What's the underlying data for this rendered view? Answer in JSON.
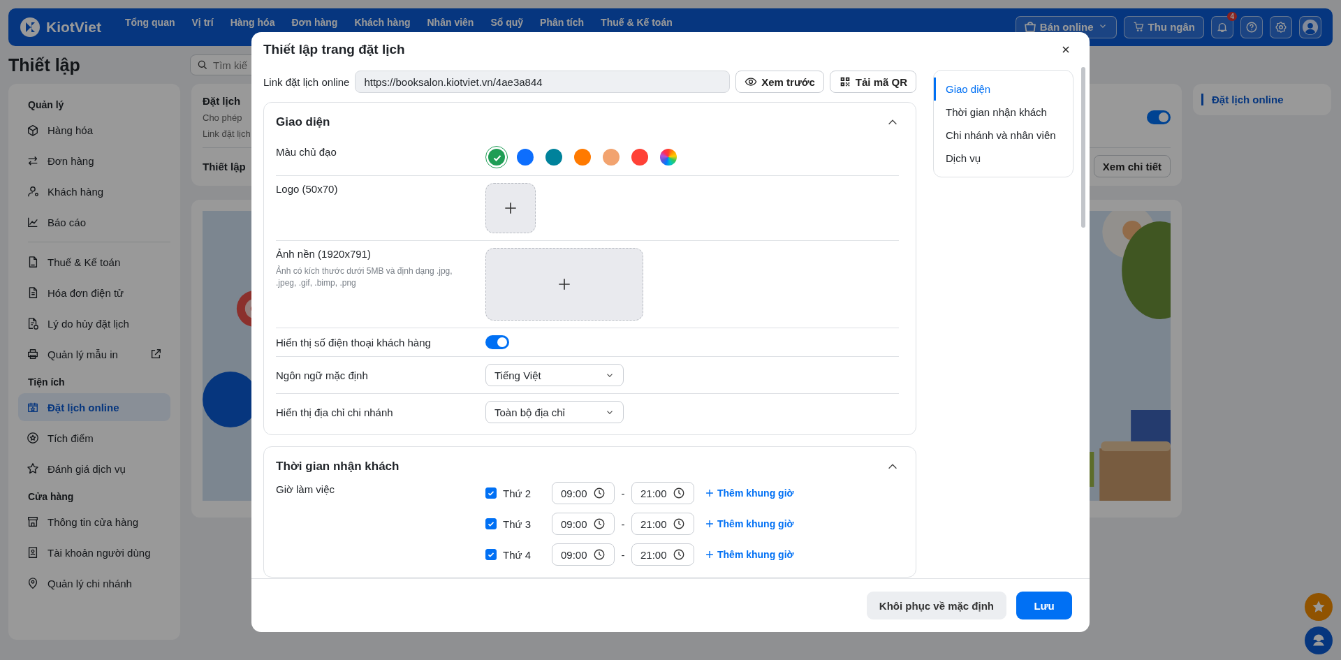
{
  "nav": {
    "logo": "KiotViet",
    "items": [
      {
        "label": "Tổng quan"
      },
      {
        "label": "Vị trí"
      },
      {
        "label": "Hàng hóa"
      },
      {
        "label": "Đơn hàng"
      },
      {
        "label": "Khách hàng"
      },
      {
        "label": "Nhân viên"
      },
      {
        "label": "Sổ quỹ"
      },
      {
        "label": "Phân tích"
      },
      {
        "label": "Thuế & Kế toán"
      }
    ],
    "sell_button": "Bán online",
    "cashier_button": "Thu ngân",
    "notification_count": "4"
  },
  "page": {
    "title": "Thiết lập",
    "search": {
      "placeholder": "Tìm kiế"
    }
  },
  "sidebar": {
    "groups": [
      {
        "heading": "Quản lý",
        "items": [
          {
            "label": "Hàng hóa",
            "selected": false,
            "external": false
          },
          {
            "label": "Đơn hàng",
            "selected": false,
            "external": false
          },
          {
            "label": "Khách hàng",
            "selected": false,
            "external": false
          },
          {
            "label": "Báo cáo",
            "selected": false,
            "external": false
          }
        ]
      },
      {
        "items": [
          {
            "label": "Thuế & Kế toán",
            "selected": false,
            "external": false
          },
          {
            "label": "Hóa đơn điện tử",
            "selected": false,
            "external": false
          },
          {
            "label": "Lý do hủy đặt lịch",
            "selected": false,
            "external": false
          },
          {
            "label": "Quản lý mẫu in",
            "selected": false,
            "external": true
          }
        ]
      },
      {
        "heading": "Tiện ích",
        "items": [
          {
            "label": "Đặt lịch online",
            "selected": true,
            "external": false
          },
          {
            "label": "Tích điểm",
            "selected": false,
            "external": false
          },
          {
            "label": "Đánh giá dịch vụ",
            "selected": false,
            "external": false
          }
        ]
      },
      {
        "heading": "Cửa hàng",
        "items": [
          {
            "label": "Thông tin cửa hàng",
            "selected": false,
            "external": false
          },
          {
            "label": "Tài khoản người dùng",
            "selected": false,
            "external": false
          },
          {
            "label": "Quản lý chi nhánh",
            "selected": false,
            "external": false
          }
        ]
      }
    ]
  },
  "content": {
    "booking_card": {
      "title": "Đặt lịch",
      "description": "Cho phép",
      "link_label": "Link đặt lịch",
      "enabled": true,
      "setup_label": "Thiết lập",
      "detail_button": "Xem chi tiết"
    }
  },
  "right_nav": {
    "items": [
      {
        "label": "Đặt lịch online",
        "selected": true
      }
    ]
  },
  "modal": {
    "title": "Thiết lập trang đặt lịch",
    "link_label": "Link đặt lịch online",
    "link_value": "https://booksalon.kiotviet.vn/4ae3a844",
    "preview_button": "Xem trước",
    "qr_button": "Tải mã QR",
    "appearance": {
      "title": "Giao diện",
      "expanded": true,
      "color_label": "Màu chủ đạo",
      "colors": [
        {
          "kind": "solid",
          "color": "#1f9d55",
          "selected": true
        },
        {
          "kind": "solid",
          "color": "#0d6efd",
          "selected": false
        },
        {
          "kind": "solid",
          "color": "#00829b",
          "selected": false
        },
        {
          "kind": "solid",
          "color": "#ff7a00",
          "selected": false
        },
        {
          "kind": "solid",
          "color": "#f2a36f",
          "selected": false
        },
        {
          "kind": "solid",
          "color": "#ff4136",
          "selected": false
        },
        {
          "kind": "gradient",
          "selected": false
        }
      ],
      "logo_label": "Logo (50x70)",
      "background_label": "Ảnh nền (1920x791)",
      "background_hint": "Ảnh có kích thước dưới 5MB và định dạng .jpg, .jpeg, .gif, .bimp, .png",
      "phone_label": "Hiển thị số điện thoại khách hàng",
      "phone_on": true,
      "language_label": "Ngôn ngữ mặc định",
      "language_value": "Tiếng Việt",
      "address_label": "Hiển thị địa chỉ chi nhánh",
      "address_value": "Toàn bộ địa chỉ"
    },
    "hours": {
      "title": "Thời gian nhận khách",
      "expanded": true,
      "label": "Giờ làm việc",
      "days": [
        {
          "label": "Thứ 2",
          "checked": true,
          "start": "09:00",
          "separator": "-",
          "end": "21:00",
          "add": "Thêm khung giờ"
        },
        {
          "label": "Thứ 3",
          "checked": true,
          "start": "09:00",
          "separator": "-",
          "end": "21:00",
          "add": "Thêm khung giờ"
        },
        {
          "label": "Thứ 4",
          "checked": true,
          "start": "09:00",
          "separator": "-",
          "end": "21:00",
          "add": "Thêm khung giờ"
        }
      ]
    },
    "side_nav": [
      {
        "label": "Giao diện",
        "selected": true
      },
      {
        "label": "Thời gian nhận khách",
        "selected": false
      },
      {
        "label": "Chi nhánh và nhân viên",
        "selected": false
      },
      {
        "label": "Dịch vụ",
        "selected": false
      }
    ],
    "reset_button": "Khôi phục về mặc định",
    "save_button": "Lưu"
  }
}
